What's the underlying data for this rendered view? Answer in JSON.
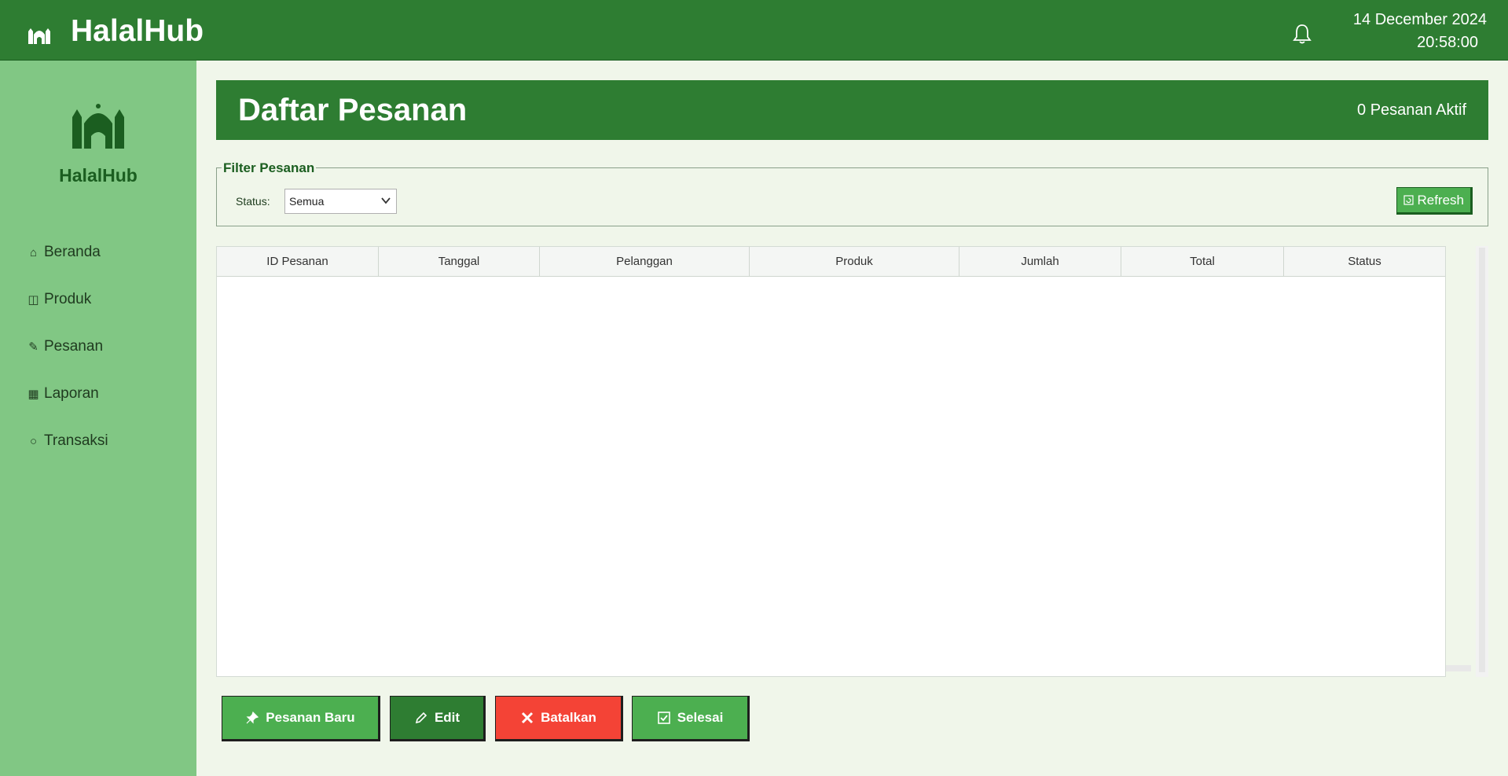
{
  "topbar": {
    "app_title": "HalalHub",
    "date": "14 December 2024",
    "time": "20:58:00"
  },
  "sidebar": {
    "brand_name": "HalalHub",
    "items": [
      {
        "label": "Beranda",
        "icon": "home-icon"
      },
      {
        "label": "Produk",
        "icon": "box-icon"
      },
      {
        "label": "Pesanan",
        "icon": "order-edit-icon"
      },
      {
        "label": "Laporan",
        "icon": "bar-chart-icon"
      },
      {
        "label": "Transaksi",
        "icon": "money-bag-icon"
      }
    ]
  },
  "header": {
    "page_title": "Daftar Pesanan",
    "active_count": "0 Pesanan Aktif"
  },
  "filter": {
    "legend": "Filter Pesanan",
    "status_label": "Status:",
    "status_value": "Semua",
    "refresh_label": "Refresh"
  },
  "table": {
    "columns": [
      "ID Pesanan",
      "Tanggal",
      "Pelanggan",
      "Produk",
      "Jumlah",
      "Total",
      "Status"
    ],
    "rows": []
  },
  "actions": {
    "new_label": "Pesanan Baru",
    "edit_label": "Edit",
    "cancel_label": "Batalkan",
    "done_label": "Selesai"
  },
  "colors": {
    "primary": "#2e7d32",
    "sidebar": "#81c784",
    "accent_green": "#4caf50",
    "danger": "#f44336",
    "background": "#f0f6ea"
  }
}
